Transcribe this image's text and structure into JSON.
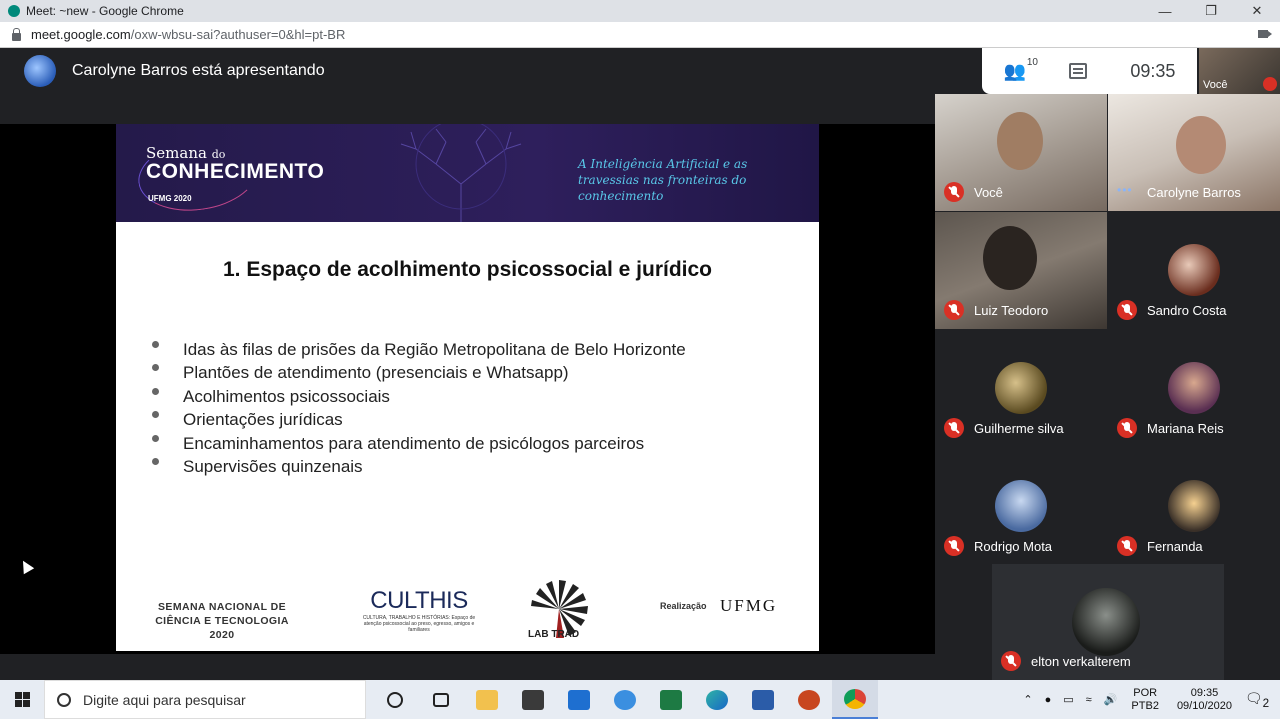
{
  "browser": {
    "window_title": "Meet: ~new - Google Chrome",
    "url_host": "meet.google.com",
    "url_path": "/oxw-wbsu-sai?authuser=0&hl=pt-BR",
    "win_minimize": "—",
    "win_restore": "❐",
    "win_close": "✕"
  },
  "meet": {
    "presenting_text": "Carolyne Barros está apresentando",
    "participant_count": "10",
    "clock": "09:35",
    "self_label": "Você"
  },
  "slide": {
    "banner_line1_a": "Semana ",
    "banner_line1_b": "do",
    "banner_line2": "CONHECIMENTO",
    "banner_sub": "UFMG 2020",
    "tagline": "A Inteligência Artificial e as travessias nas fronteiras do conhecimento",
    "heading": "1. Espaço de acolhimento psicossocial e jurídico",
    "bullets": [
      "Idas às filas de prisões da Região Metropolitana de Belo Horizonte",
      "Plantões de atendimento (presenciais e Whatsapp)",
      "Acolhimentos psicossociais",
      "Orientações jurídicas",
      "Encaminhamentos para atendimento de psicólogos parceiros",
      "Supervisões quinzenais"
    ],
    "footer_snct_1": "SEMANA NACIONAL DE",
    "footer_snct_2": "CIÊNCIA E TECNOLOGIA 2020",
    "footer_culthis": "CULTHIS",
    "footer_culthis_sub": "CULTURA, TRABALHO E HISTÓRIAS: Espaço de atenção psicossocial ao preso, egresso, amigos e familiares",
    "footer_labtrad": "LAB TRAD",
    "footer_realizacao": "Realização",
    "footer_ufmg": "UFMG"
  },
  "participants": [
    {
      "name": "Você",
      "muted": true
    },
    {
      "name": "Carolyne Barros",
      "muted": false
    },
    {
      "name": "Luiz Teodoro",
      "muted": true
    },
    {
      "name": "Sandro Costa",
      "muted": true
    },
    {
      "name": "Guilherme silva",
      "muted": true
    },
    {
      "name": "Mariana Reis",
      "muted": true
    },
    {
      "name": "Rodrigo Mota",
      "muted": true
    },
    {
      "name": "Fernanda",
      "muted": true
    },
    {
      "name": "elton verkalterem",
      "muted": true
    }
  ],
  "taskbar": {
    "search_placeholder": "Digite aqui para pesquisar",
    "lang_1": "POR",
    "lang_2": "PTB2",
    "time": "09:35",
    "date": "09/10/2020",
    "notifications": "2"
  },
  "colors": {
    "meet_bg": "#202124",
    "mute_red": "#d93025",
    "banner_purple": "#2e1f5c",
    "tagline_cyan": "#59c7e8"
  }
}
